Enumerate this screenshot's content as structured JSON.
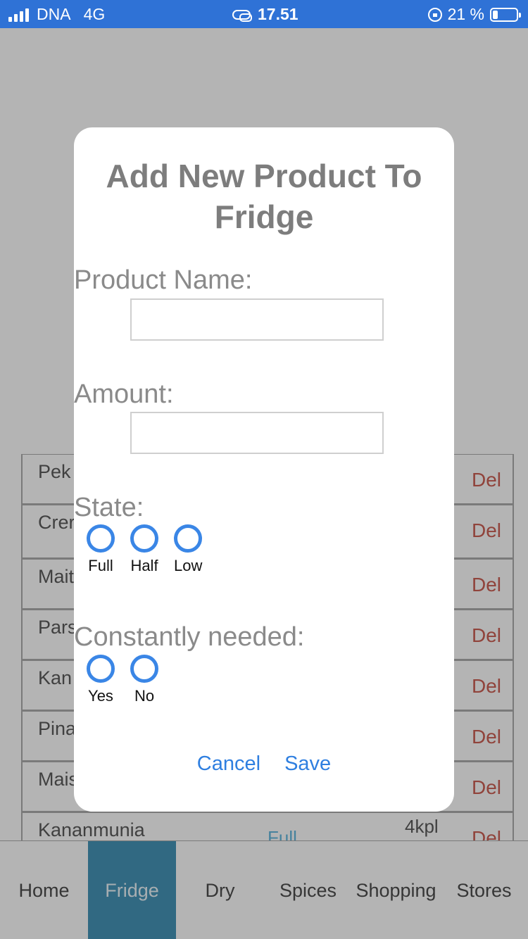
{
  "status_bar": {
    "carrier": "DNA",
    "network": "4G",
    "time": "17.51",
    "battery_text": "21 %",
    "battery_level": 0.21,
    "icons": [
      "signal-icon",
      "link-icon",
      "rotation-lock-icon",
      "battery-icon"
    ]
  },
  "modal": {
    "title": "Add New Product To Fridge",
    "product_name_label": "Product Name:",
    "product_name_value": "",
    "amount_label": "Amount:",
    "amount_value": "",
    "state_label": "State:",
    "state_options": [
      "Full",
      "Half",
      "Low"
    ],
    "constantly_needed_label": "Constantly needed:",
    "constantly_needed_options": [
      "Yes",
      "No"
    ],
    "cancel_label": "Cancel",
    "save_label": "Save"
  },
  "background": {
    "products": [
      {
        "name": "Pek",
        "state": "",
        "amount": "",
        "del": "Del"
      },
      {
        "name": "Crer fraic",
        "state": "",
        "amount": "",
        "del": "Del"
      },
      {
        "name": "Mait",
        "state": "",
        "amount": "",
        "del": "Del"
      },
      {
        "name": "Pars",
        "state": "",
        "amount": "",
        "del": "Del"
      },
      {
        "name": "Kan",
        "state": "",
        "amount": "",
        "del": "Del"
      },
      {
        "name": "Pina",
        "state": "",
        "amount": "",
        "del": "Del"
      },
      {
        "name": "Mais",
        "state": "",
        "amount": "",
        "del": "Del"
      },
      {
        "name": "Kananmunia",
        "state": "Full",
        "amount": "4kpl",
        "del": "Del"
      }
    ]
  },
  "tabs": [
    {
      "label": "Home",
      "active": false
    },
    {
      "label": "Fridge",
      "active": true
    },
    {
      "label": "Dry",
      "active": false
    },
    {
      "label": "Spices",
      "active": false
    },
    {
      "label": "Shopping",
      "active": false
    },
    {
      "label": "Stores",
      "active": false
    }
  ],
  "colors": {
    "status_bar": "#2f72d6",
    "accent": "#3a86e6",
    "tab_active": "#1a7ba8",
    "delete": "#c0392b"
  }
}
